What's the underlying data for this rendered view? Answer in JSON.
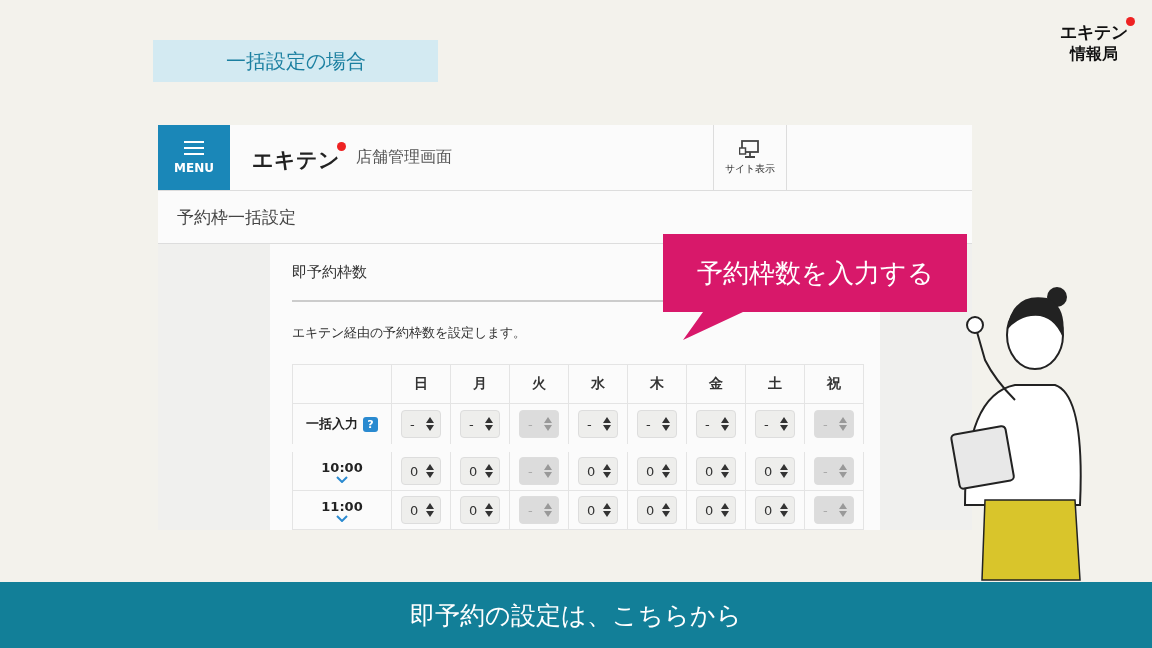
{
  "section_label": "一括設定の場合",
  "corner_logo": {
    "top": "エキテン",
    "bottom": "情報局"
  },
  "app": {
    "menu_label": "MENU",
    "brand": "エキテン",
    "subtitle": "店舗管理画面",
    "site_button": "サイト表示",
    "page_title": "予約枠一括設定",
    "heading": "即予約枠数",
    "description": "エキテン経由の予約枠数を設定します。",
    "days": [
      {
        "label": "日"
      },
      {
        "label": "月"
      },
      {
        "label": "火"
      },
      {
        "label": "水"
      },
      {
        "label": "木"
      },
      {
        "label": "金"
      },
      {
        "label": "土"
      },
      {
        "label": "祝"
      }
    ],
    "rows": [
      {
        "label": "一括入力",
        "kind": "bulk",
        "help": "?",
        "cells": [
          {
            "value": "-",
            "disabled": false
          },
          {
            "value": "-",
            "disabled": false
          },
          {
            "value": "-",
            "disabled": true
          },
          {
            "value": "-",
            "disabled": false
          },
          {
            "value": "-",
            "disabled": false
          },
          {
            "value": "-",
            "disabled": false
          },
          {
            "value": "-",
            "disabled": false
          },
          {
            "value": "-",
            "disabled": true
          }
        ]
      },
      {
        "label": "10:00",
        "kind": "time",
        "cells": [
          {
            "value": "0",
            "disabled": false
          },
          {
            "value": "0",
            "disabled": false
          },
          {
            "value": "-",
            "disabled": true
          },
          {
            "value": "0",
            "disabled": false
          },
          {
            "value": "0",
            "disabled": false
          },
          {
            "value": "0",
            "disabled": false
          },
          {
            "value": "0",
            "disabled": false
          },
          {
            "value": "-",
            "disabled": true
          }
        ]
      },
      {
        "label": "11:00",
        "kind": "time",
        "cells": [
          {
            "value": "0",
            "disabled": false
          },
          {
            "value": "0",
            "disabled": false
          },
          {
            "value": "-",
            "disabled": true
          },
          {
            "value": "0",
            "disabled": false
          },
          {
            "value": "0",
            "disabled": false
          },
          {
            "value": "0",
            "disabled": false
          },
          {
            "value": "0",
            "disabled": false
          },
          {
            "value": "-",
            "disabled": true
          }
        ]
      }
    ]
  },
  "callout": "予約枠数を入力する",
  "subtitle_bar": "即予約の設定は、こちらから"
}
